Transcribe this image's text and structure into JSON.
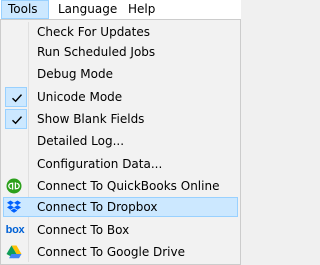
{
  "menubar": {
    "items": [
      {
        "label": "Tools"
      },
      {
        "label": "Language"
      },
      {
        "label": "Help"
      }
    ]
  },
  "tools_menu": {
    "items": [
      {
        "label": "Check For Updates"
      },
      {
        "label": "Run Scheduled Jobs"
      },
      {
        "label": "Debug Mode"
      },
      {
        "label": "Unicode Mode",
        "checked": true
      },
      {
        "label": "Show Blank Fields",
        "checked": true
      },
      {
        "label": "Detailed Log..."
      },
      {
        "label": "Configuration Data..."
      },
      {
        "label": "Connect To QuickBooks Online",
        "icon": "quickbooks-icon"
      },
      {
        "label": "Connect To Dropbox",
        "icon": "dropbox-icon",
        "highlighted": true
      },
      {
        "label": "Connect To Box",
        "icon": "box-icon",
        "icon_text": "box"
      },
      {
        "label": "Connect To Google Drive",
        "icon": "google-drive-icon"
      }
    ]
  },
  "colors": {
    "highlight": "#cce8ff",
    "highlight_border": "#99d1ff",
    "quickbooks": "#2ca01c",
    "dropbox": "#0061fe",
    "box": "#0061d5"
  }
}
